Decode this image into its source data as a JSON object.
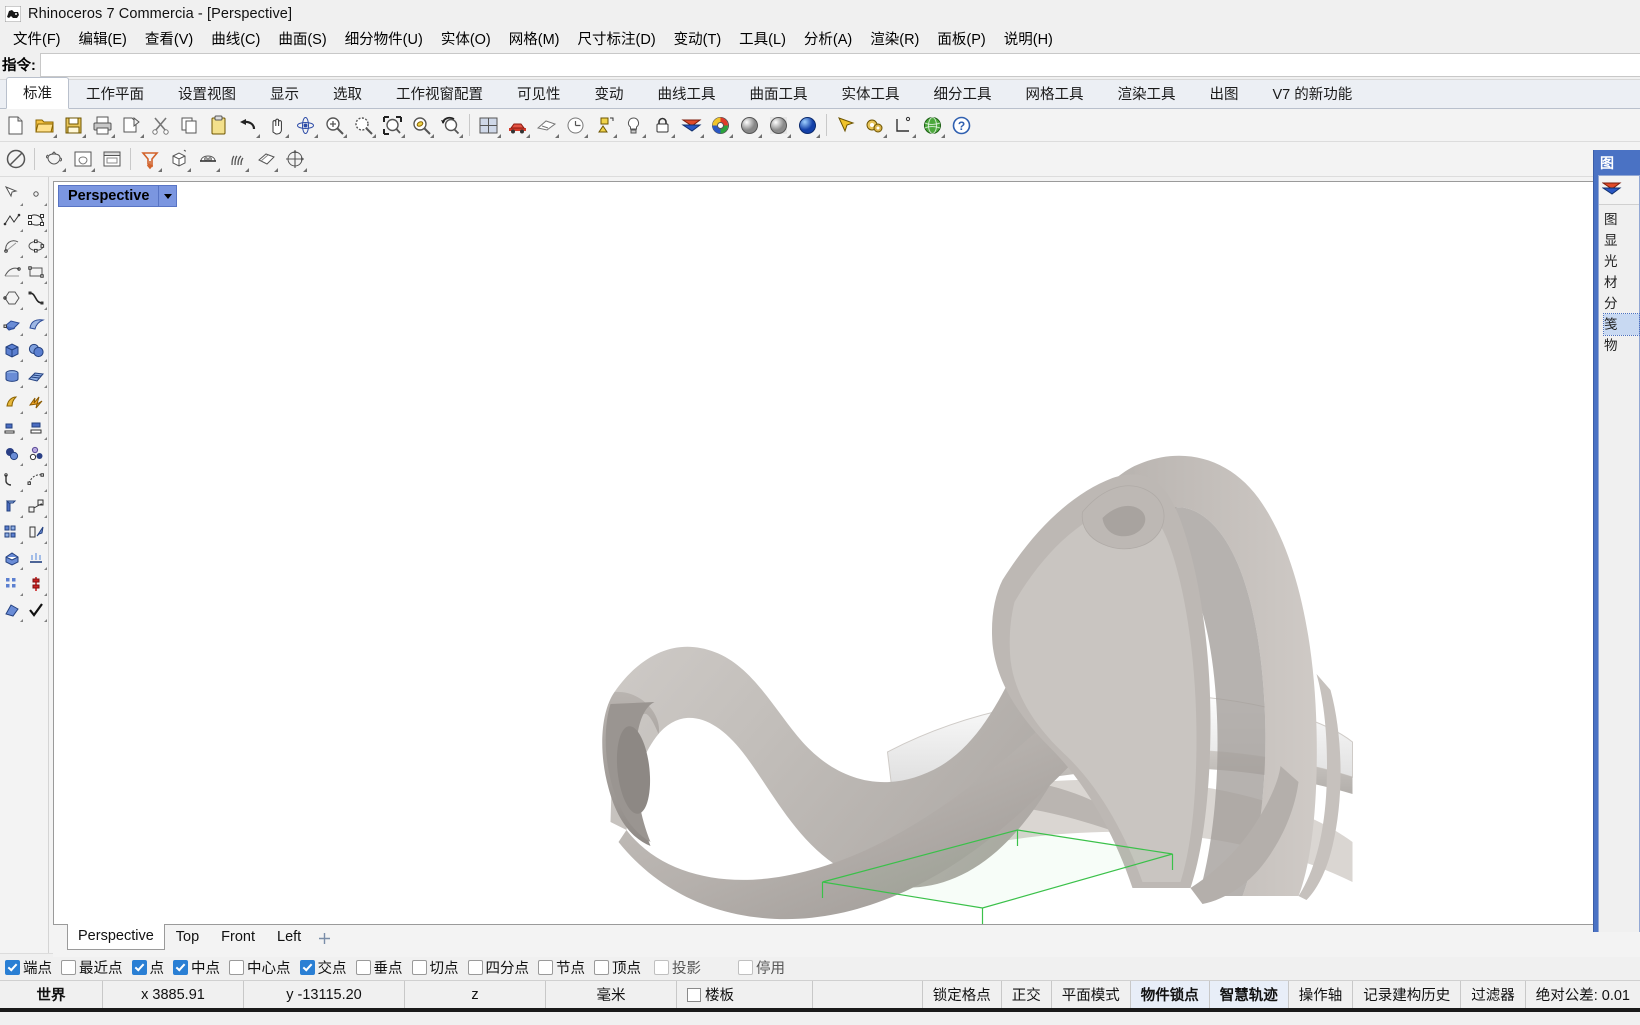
{
  "window": {
    "title": "Rhinoceros 7 Commercia - [Perspective]",
    "icon": "rhino-logo-icon"
  },
  "menubar": {
    "items": [
      {
        "label": "文件(F)",
        "name": "menu-file"
      },
      {
        "label": "编辑(E)",
        "name": "menu-edit"
      },
      {
        "label": "查看(V)",
        "name": "menu-view"
      },
      {
        "label": "曲线(C)",
        "name": "menu-curve"
      },
      {
        "label": "曲面(S)",
        "name": "menu-surface"
      },
      {
        "label": "细分物件(U)",
        "name": "menu-subd"
      },
      {
        "label": "实体(O)",
        "name": "menu-solid"
      },
      {
        "label": "网格(M)",
        "name": "menu-mesh"
      },
      {
        "label": "尺寸标注(D)",
        "name": "menu-dimension"
      },
      {
        "label": "变动(T)",
        "name": "menu-transform"
      },
      {
        "label": "工具(L)",
        "name": "menu-tools"
      },
      {
        "label": "分析(A)",
        "name": "menu-analyze"
      },
      {
        "label": "渲染(R)",
        "name": "menu-render"
      },
      {
        "label": "面板(P)",
        "name": "menu-panels"
      },
      {
        "label": "说明(H)",
        "name": "menu-help"
      }
    ]
  },
  "command": {
    "label": "指令:",
    "value": "",
    "placeholder": ""
  },
  "tabs": {
    "active_index": 0,
    "items": [
      {
        "label": "标准",
        "name": "tab-standard"
      },
      {
        "label": "工作平面",
        "name": "tab-cplane"
      },
      {
        "label": "设置视图",
        "name": "tab-set-view"
      },
      {
        "label": "显示",
        "name": "tab-display"
      },
      {
        "label": "选取",
        "name": "tab-select"
      },
      {
        "label": "工作视窗配置",
        "name": "tab-viewport-layout"
      },
      {
        "label": "可见性",
        "name": "tab-visibility"
      },
      {
        "label": "变动",
        "name": "tab-transform"
      },
      {
        "label": "曲线工具",
        "name": "tab-curve-tools"
      },
      {
        "label": "曲面工具",
        "name": "tab-surface-tools"
      },
      {
        "label": "实体工具",
        "name": "tab-solid-tools"
      },
      {
        "label": "细分工具",
        "name": "tab-subd-tools"
      },
      {
        "label": "网格工具",
        "name": "tab-mesh-tools"
      },
      {
        "label": "渲染工具",
        "name": "tab-render-tools"
      },
      {
        "label": "出图",
        "name": "tab-drafting"
      },
      {
        "label": "V7 的新功能",
        "name": "tab-whats-new-v7"
      }
    ]
  },
  "toolbar_row1": [
    {
      "name": "new-file-icon",
      "title": "新建"
    },
    {
      "name": "open-file-icon",
      "title": "开启"
    },
    {
      "name": "save-file-icon",
      "title": "储存"
    },
    {
      "name": "print-icon",
      "title": "列印"
    },
    {
      "name": "cut-object-icon",
      "title": "剪下"
    },
    {
      "name": "scissors-icon",
      "title": "剪刀"
    },
    {
      "name": "copy-icon",
      "title": "复制"
    },
    {
      "name": "paste-icon",
      "title": "贴上"
    },
    {
      "name": "undo-icon",
      "title": "复原"
    },
    {
      "name": "pan-hand-icon",
      "title": "平移"
    },
    {
      "name": "rotate-view-icon",
      "title": "旋转视图"
    },
    {
      "name": "zoom-in-icon",
      "title": "放大"
    },
    {
      "name": "zoom-window-icon",
      "title": "视窗缩放"
    },
    {
      "name": "zoom-extents-icon",
      "title": "缩放至最大范围"
    },
    {
      "name": "zoom-selected-icon",
      "title": "缩放至选取物件"
    },
    {
      "name": "zoom-previous-icon",
      "title": "还原上一个视图"
    },
    {
      "name": "viewport-layout-icon",
      "title": "工作视窗配置"
    },
    {
      "name": "car-render-icon",
      "title": "渲染"
    },
    {
      "name": "plane-sketch-icon",
      "title": "草图"
    },
    {
      "name": "clock-icon",
      "title": "历史"
    },
    {
      "name": "select-objects-icon",
      "title": "选取物件"
    },
    {
      "name": "light-bulb-icon",
      "title": "灯光"
    },
    {
      "name": "lock-icon",
      "title": "锁定"
    },
    {
      "name": "layer-icon",
      "title": "图层"
    },
    {
      "name": "color-wheel-icon",
      "title": "颜色"
    },
    {
      "name": "shaded-sphere-icon",
      "title": "着色模式"
    },
    {
      "name": "rendered-sphere-icon",
      "title": "渲染模式"
    },
    {
      "name": "blue-sphere-icon",
      "title": "材质"
    },
    {
      "name": "cursor-arrow-icon",
      "title": "选取"
    },
    {
      "name": "gears-icon",
      "title": "设定"
    },
    {
      "name": "dimension-icon",
      "title": "尺寸标注"
    },
    {
      "name": "globe-icon",
      "title": "网页"
    },
    {
      "name": "help-icon",
      "title": "说明"
    }
  ],
  "toolbar_row2": [
    {
      "name": "no-entry-icon",
      "title": "停用"
    },
    {
      "name": "teapot-icon",
      "title": "茶壶"
    },
    {
      "name": "teapot-frame-icon",
      "title": "茶壶框"
    },
    {
      "name": "window-frame-icon",
      "title": "视窗"
    },
    {
      "name": "funnel-orange-icon",
      "title": "漏斗"
    },
    {
      "name": "box-cube-icon",
      "title": "立方体"
    },
    {
      "name": "object-table-icon",
      "title": "物件"
    },
    {
      "name": "grass-icon",
      "title": "草"
    },
    {
      "name": "tag-icon",
      "title": "标签"
    },
    {
      "name": "gumball-icon",
      "title": "操作轴"
    }
  ],
  "left_toolbar": [
    {
      "name": "arrow-select-icon"
    },
    {
      "name": "point-icon"
    },
    {
      "name": "polyline-icon"
    },
    {
      "name": "control-point-curve-icon"
    },
    {
      "name": "arc-icon"
    },
    {
      "name": "ellipse-icon"
    },
    {
      "name": "conic-icon"
    },
    {
      "name": "rectangle-icon"
    },
    {
      "name": "polygon-icon"
    },
    {
      "name": "curve-interp-icon"
    },
    {
      "name": "surface-patch-icon"
    },
    {
      "name": "loft-surface-icon"
    },
    {
      "name": "box-solid-icon"
    },
    {
      "name": "sphere-union-icon"
    },
    {
      "name": "cylinder-icon"
    },
    {
      "name": "mesh-solid-icon"
    },
    {
      "name": "deform-cage-icon"
    },
    {
      "name": "explode-icon"
    },
    {
      "name": "trim-icon"
    },
    {
      "name": "split-icon"
    },
    {
      "name": "boolean-icon"
    },
    {
      "name": "blend-circles-icon"
    },
    {
      "name": "fillet-curve-icon"
    },
    {
      "name": "offset-curve-icon"
    },
    {
      "name": "extrude-icon"
    },
    {
      "name": "move-copy-icon"
    },
    {
      "name": "array-rect-icon"
    },
    {
      "name": "scale-icon"
    },
    {
      "name": "cap-solid-icon"
    },
    {
      "name": "flow-surface-icon"
    },
    {
      "name": "grid-array-icon"
    },
    {
      "name": "analyze-dir-icon"
    },
    {
      "name": "render-tool-icon"
    },
    {
      "name": "check-object-icon"
    }
  ],
  "viewport": {
    "label": "Perspective",
    "dropdown_icon": "chevron-down-icon",
    "tabs": [
      {
        "label": "Perspective",
        "name": "viewport-tab-perspective",
        "active": true
      },
      {
        "label": "Top",
        "name": "viewport-tab-top",
        "active": false
      },
      {
        "label": "Front",
        "name": "viewport-tab-front",
        "active": false
      },
      {
        "label": "Left",
        "name": "viewport-tab-left",
        "active": false
      }
    ],
    "add_tab_icon": "plus-icon",
    "model_description": "organic parametric surface pavilion model, shaded gray NURBS surfaces with white interior slab and green bounding box wireframe",
    "colors": {
      "background": "#ffffff",
      "surface_light": "#cfcbc8",
      "surface_mid": "#b7b2ae",
      "surface_dark": "#9b9693",
      "slab_white": "#f2f2f2",
      "bbox_green": "#3bc14a"
    }
  },
  "right_panel": {
    "title": "图",
    "items": [
      {
        "label": "图"
      },
      {
        "label": "显"
      },
      {
        "label": "光"
      },
      {
        "label": "材"
      },
      {
        "label": "分"
      },
      {
        "label": "笺",
        "selected": true
      },
      {
        "label": "物"
      }
    ]
  },
  "osnap": {
    "items": [
      {
        "label": "端点",
        "checked": true,
        "name": "osnap-end"
      },
      {
        "label": "最近点",
        "checked": false,
        "name": "osnap-near"
      },
      {
        "label": "点",
        "checked": true,
        "name": "osnap-point"
      },
      {
        "label": "中点",
        "checked": true,
        "name": "osnap-mid"
      },
      {
        "label": "中心点",
        "checked": false,
        "name": "osnap-center"
      },
      {
        "label": "交点",
        "checked": true,
        "name": "osnap-int"
      },
      {
        "label": "垂点",
        "checked": false,
        "name": "osnap-perp"
      },
      {
        "label": "切点",
        "checked": false,
        "name": "osnap-tan"
      },
      {
        "label": "四分点",
        "checked": false,
        "name": "osnap-quad"
      },
      {
        "label": "节点",
        "checked": false,
        "name": "osnap-knot"
      },
      {
        "label": "顶点",
        "checked": false,
        "name": "osnap-vertex"
      },
      {
        "label": "投影",
        "checked": false,
        "dim": true,
        "name": "osnap-project"
      },
      {
        "label": "停用",
        "checked": false,
        "dim": true,
        "name": "osnap-disable"
      }
    ]
  },
  "statusbar": {
    "cplane": "世界",
    "x": "x 3885.91",
    "y": "y -13115.20",
    "z": "z",
    "units": "毫米",
    "layer_checkbox_label": "楼板",
    "toggles": [
      {
        "label": "锁定格点",
        "active": false,
        "name": "status-grid-snap"
      },
      {
        "label": "正交",
        "active": false,
        "name": "status-ortho"
      },
      {
        "label": "平面模式",
        "active": false,
        "name": "status-planar"
      },
      {
        "label": "物件锁点",
        "active": true,
        "name": "status-osnap"
      },
      {
        "label": "智慧轨迹",
        "active": true,
        "name": "status-smart-track"
      },
      {
        "label": "操作轴",
        "active": false,
        "name": "status-gumball"
      },
      {
        "label": "记录建构历史",
        "active": false,
        "name": "status-history"
      },
      {
        "label": "过滤器",
        "active": false,
        "name": "status-filter"
      }
    ],
    "tolerance": "绝对公差: 0.01"
  }
}
